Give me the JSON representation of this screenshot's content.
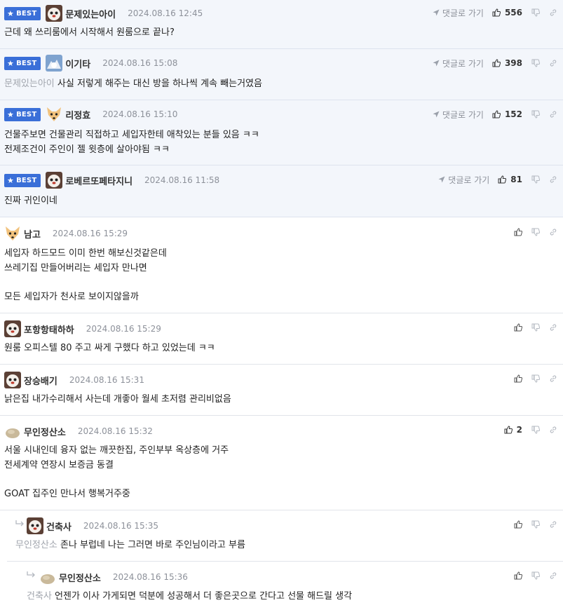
{
  "reply_link_label": "댓글로 가기",
  "best_label": "BEST",
  "colors": {
    "best_badge": "#3a6fd8",
    "best_bg": "#f3f6fb",
    "mention": "#a2a6ae"
  },
  "comments": [
    {
      "best": true,
      "avatar": "dog-avatar",
      "nick": "문제있는아이",
      "time": "2024.08.16 12:45",
      "likes": "556",
      "mention": "",
      "text": "근데 왜 쓰리룸에서 시작해서 원룸으로 끝나?"
    },
    {
      "best": true,
      "avatar": "snow-avatar",
      "nick": "이기타",
      "time": "2024.08.16 15:08",
      "likes": "398",
      "mention": "문제있는아이",
      "text": "사실 저렇게 해주는 대신 방을 하나씩 계속 빼는거였음"
    },
    {
      "best": true,
      "avatar": "fox-avatar",
      "nick": "리정효",
      "time": "2024.08.16 15:10",
      "likes": "152",
      "mention": "",
      "text": "건물주보면 건물관리 직접하고 세입자한테 애착있는 분들 있음 ㅋㅋ\n전제조건이 주인이 젤 윗층에 살아야됨 ㅋㅋ"
    },
    {
      "best": true,
      "avatar": "dog-avatar",
      "nick": "로베르또페타지니",
      "time": "2024.08.16 11:58",
      "likes": "81",
      "mention": "",
      "text": "진짜 귀인이네"
    },
    {
      "best": false,
      "avatar": "fox-avatar",
      "nick": "남고",
      "time": "2024.08.16 15:29",
      "likes": "",
      "mention": "",
      "text": "세입자 하드모드 이미 한번 해보신것같은데\n쓰레기집 만들어버리는 세입자 만나면\n\n모든 세입자가 천사로 보이지않을까"
    },
    {
      "best": false,
      "avatar": "dog-avatar",
      "nick": "포항항태하하",
      "time": "2024.08.16 15:29",
      "likes": "",
      "mention": "",
      "text": "원룸 오피스텔 80 주고 싸게 구했다 하고 있었는데 ㅋㅋ"
    },
    {
      "best": false,
      "avatar": "dog-avatar",
      "nick": "장승배기",
      "time": "2024.08.16 15:31",
      "likes": "",
      "mention": "",
      "text": "낡은집 내가수리해서 사는데 개좋아 월세 초저렴 관리비없음"
    },
    {
      "best": false,
      "avatar": "rock-avatar",
      "nick": "무인정산소",
      "time": "2024.08.16 15:32",
      "likes": "2",
      "mention": "",
      "text": "서울 시내인데 융자 없는 깨끗한집, 주인부부 옥상층에 거주\n전세계약 연장시 보증금 동결\n\nGOAT 집주인 만나서 행복거주중"
    },
    {
      "best": false,
      "avatar": "dog-avatar",
      "nick": "건축사",
      "time": "2024.08.16 15:35",
      "likes": "",
      "mention": "무인정산소",
      "text": "존나 부럽네 나는 그러면 바로 주인님이라고 부름"
    },
    {
      "best": false,
      "avatar": "rock-avatar",
      "nick": "무인정산소",
      "time": "2024.08.16 15:36",
      "likes": "",
      "mention": "건축사",
      "text": "언젠가 이사 가게되면 덕분에 성공해서 더 좋은곳으로 간다고 선물 해드릴 생각"
    }
  ]
}
